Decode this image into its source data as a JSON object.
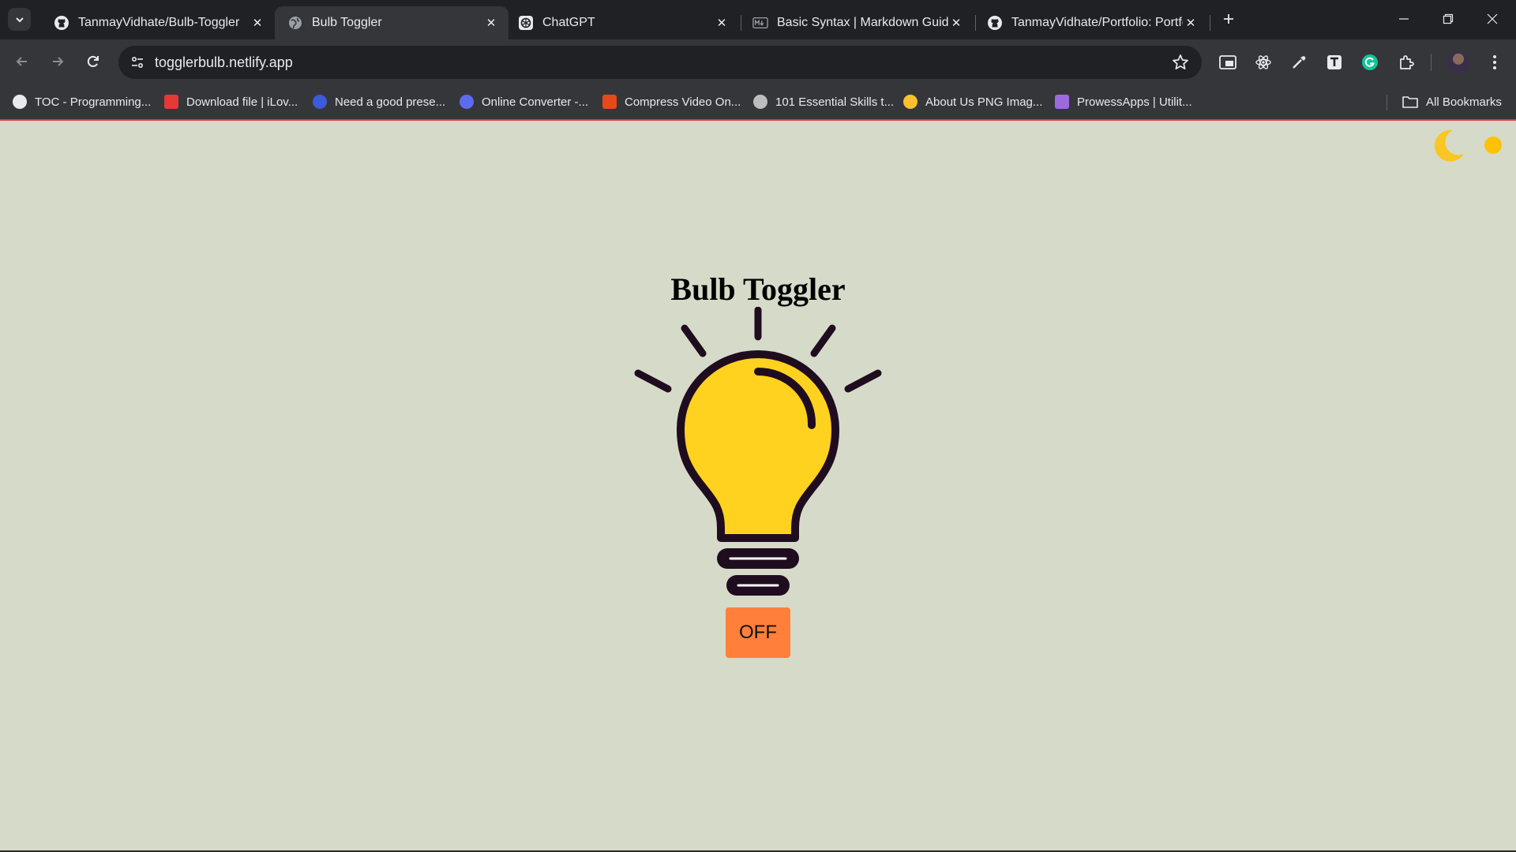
{
  "browser": {
    "tabs": [
      {
        "title": "TanmayVidhate/Bulb-Toggler",
        "icon": "github-icon",
        "active": false
      },
      {
        "title": "Bulb Toggler",
        "icon": "globe-icon",
        "active": true
      },
      {
        "title": "ChatGPT",
        "icon": "chatgpt-icon",
        "active": false
      },
      {
        "title": "Basic Syntax | Markdown Guide",
        "icon": "markdown-icon",
        "active": false
      },
      {
        "title": "TanmayVidhate/Portfolio: Portfo",
        "icon": "github-icon",
        "active": false
      }
    ],
    "address_bar": {
      "url": "togglerbulb.netlify.app"
    },
    "bookmarks": [
      {
        "label": "TOC - Programming...",
        "color": "#e8eaed"
      },
      {
        "label": "Download file | iLov...",
        "color": "#e53935"
      },
      {
        "label": "Need a good prese...",
        "color": "#3b5bdb"
      },
      {
        "label": "Online Converter -...",
        "color": "#5c6bf0"
      },
      {
        "label": "Compress Video On...",
        "color": "#e64a19"
      },
      {
        "label": "101 Essential Skills t...",
        "color": "#bdbdbd"
      },
      {
        "label": "About Us PNG Imag...",
        "color": "#fbc02d"
      },
      {
        "label": "ProwessApps | Utilit...",
        "color": "#9c6ade"
      }
    ],
    "all_bookmarks_label": "All Bookmarks"
  },
  "page": {
    "title": "Bulb Toggler",
    "toggle_button_label": "OFF",
    "bulb_state": "off",
    "colors": {
      "background": "#d6dbc9",
      "bulb_fill": "#ffd21f",
      "bulb_outline": "#1f0d1f",
      "button": "#ff7f3b",
      "moon": "#f9c623",
      "sun": "#ffc107"
    }
  }
}
